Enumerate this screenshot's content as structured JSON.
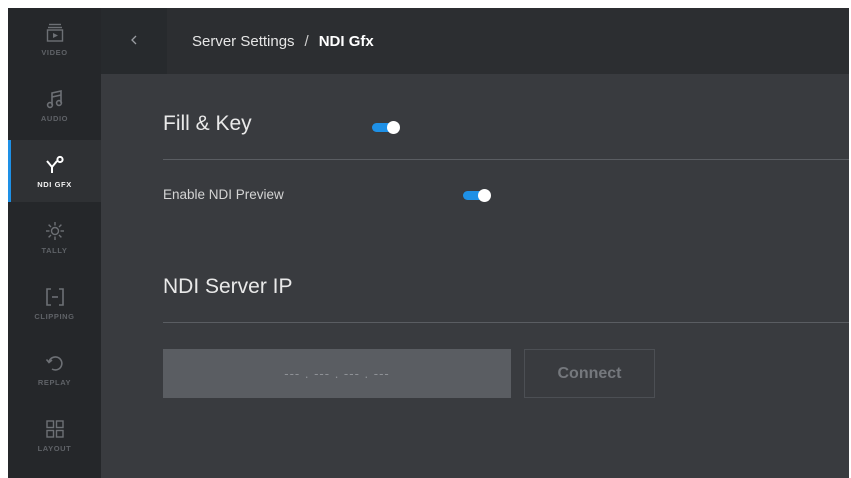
{
  "sidebar": {
    "items": [
      {
        "label": "VIDEO",
        "icon": "video-icon",
        "active": false
      },
      {
        "label": "AUDIO",
        "icon": "music-note-icon",
        "active": false
      },
      {
        "label": "NDI GFX",
        "icon": "ndi-icon",
        "active": true
      },
      {
        "label": "TALLY",
        "icon": "tally-light-icon",
        "active": false
      },
      {
        "label": "CLIPPING",
        "icon": "clipping-brackets-icon",
        "active": false
      },
      {
        "label": "REPLAY",
        "icon": "replay-icon",
        "active": false
      },
      {
        "label": "LAYOUT",
        "icon": "layout-grid-icon",
        "active": false
      }
    ]
  },
  "header": {
    "back_icon": "chevron-left-icon",
    "breadcrumb": {
      "parent": "Server Settings",
      "separator": "/",
      "current": "NDI Gfx"
    }
  },
  "main": {
    "fill_key": {
      "title": "Fill & Key",
      "toggle_on": true
    },
    "ndi_preview": {
      "label": "Enable NDI Preview",
      "toggle_on": true
    },
    "server_ip": {
      "title": "NDI Server IP",
      "placeholder": "--- . --- . --- . ---",
      "value": "",
      "connect_label": "Connect"
    }
  },
  "colors": {
    "accent": "#1e90e6",
    "background": "#393b3f",
    "sidebar": "#25272a",
    "header": "#2c2e31"
  }
}
